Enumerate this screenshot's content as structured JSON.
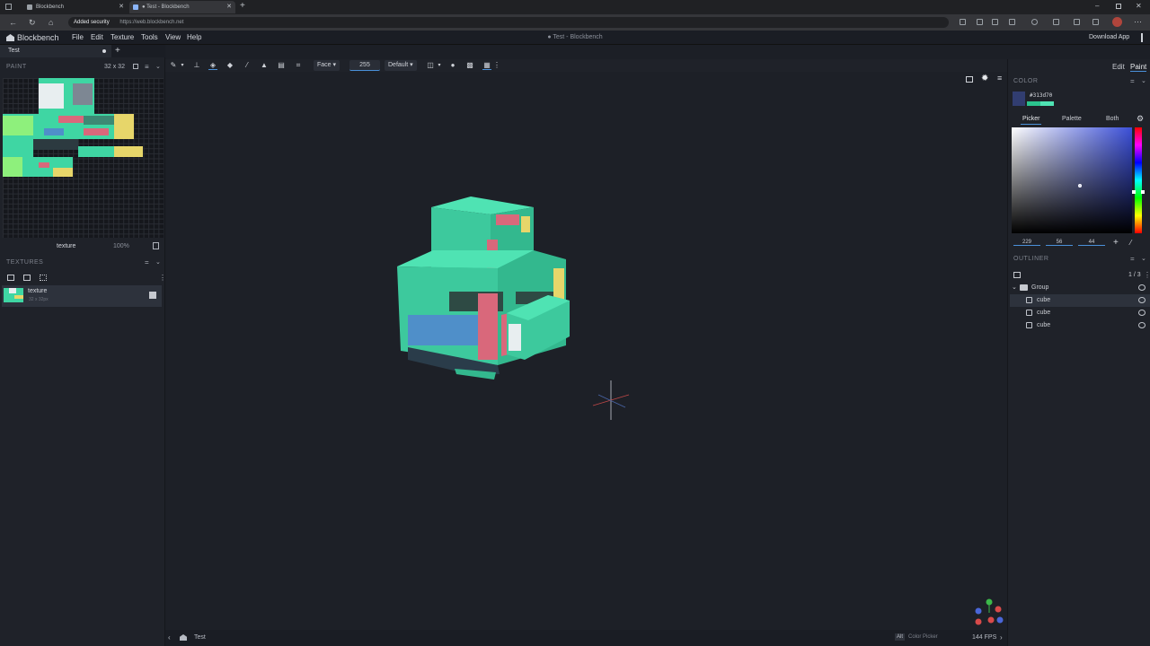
{
  "browser": {
    "tabs": [
      {
        "label": "Blockbench",
        "active": false
      },
      {
        "label": "● Test - Blockbench",
        "active": true
      }
    ],
    "security": "Added security",
    "url": "https://web.blockbench.net"
  },
  "app": {
    "logo": "Blockbench",
    "menu": [
      "File",
      "Edit",
      "Texture",
      "Tools",
      "View",
      "Help"
    ],
    "title": "● Test - Blockbench",
    "download": "Download App"
  },
  "left": {
    "tab": "Test",
    "paint_title": "PAINT",
    "resolution": "32 x 32",
    "texture_name": "texture",
    "zoom": "100%",
    "textures_title": "TEXTURES",
    "texture_item": {
      "name": "texture",
      "size": "32 x 32px"
    }
  },
  "toolbar": {
    "face_mode": "Face",
    "opacity": "255",
    "shading": "Default"
  },
  "right": {
    "mode_edit": "Edit",
    "mode_paint": "Paint",
    "color_title": "COLOR",
    "color_hex": "#313d70",
    "picker_tabs": [
      "Picker",
      "Palette",
      "Both"
    ],
    "hsv": [
      "229",
      "56",
      "44"
    ],
    "outliner_title": "OUTLINER",
    "outliner_count": "1 / 3",
    "group": "Group",
    "cubes": [
      "cube",
      "cube",
      "cube"
    ]
  },
  "status": {
    "project": "Test",
    "key": "Alt",
    "hint": "Color Picker",
    "fps": "144 FPS"
  },
  "colors": {
    "teal": "#3fd6a3",
    "pink": "#d9687b",
    "yellow": "#e7d66a",
    "blue": "#4f8fc9",
    "selected_color": "#313d70"
  }
}
